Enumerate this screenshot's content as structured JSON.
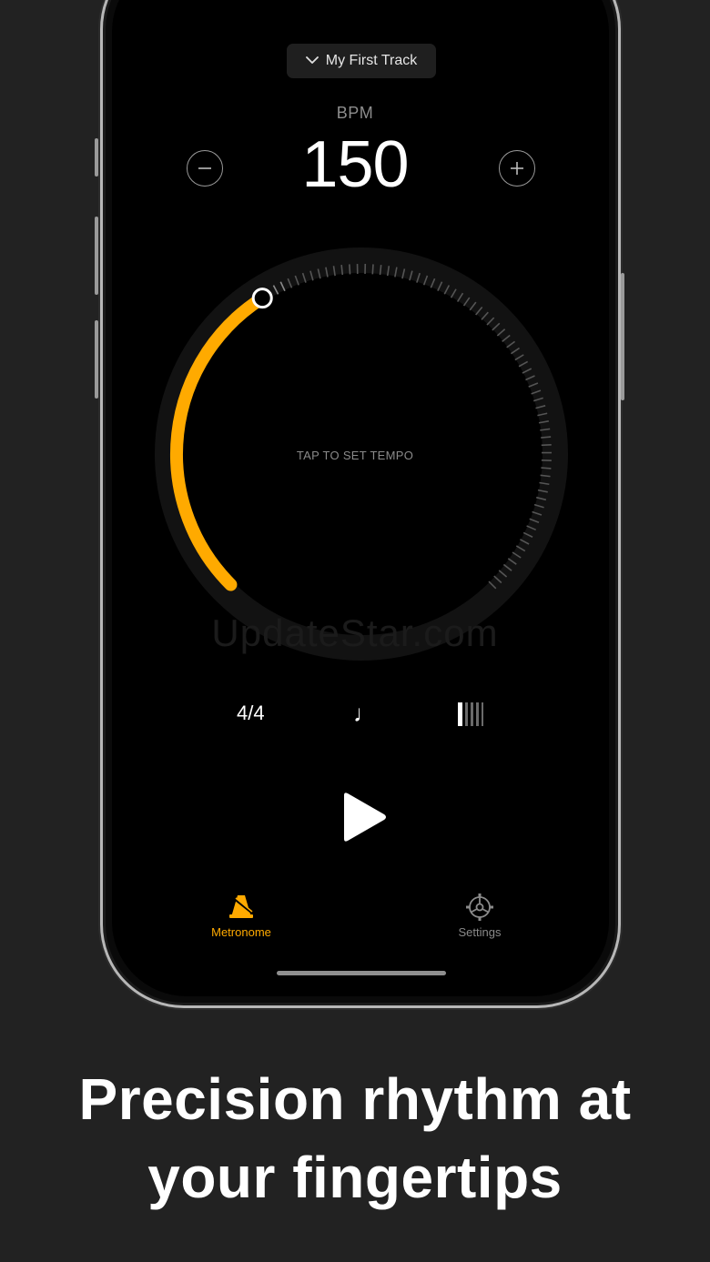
{
  "track": {
    "name": "My First Track"
  },
  "bpm": {
    "label": "BPM",
    "value": "150"
  },
  "dial": {
    "tap_label": "TAP TO SET TEMPO",
    "fill_fraction": 0.38,
    "accent": "#FFAA00"
  },
  "watermark": "UpdateStar.com",
  "controls": {
    "time_signature": "4/4",
    "note_value": "♩",
    "subdivision_icon": "bars-icon"
  },
  "tabs": [
    {
      "label": "Metronome",
      "icon": "metronome-icon",
      "active": true,
      "color": "#FFAA00"
    },
    {
      "label": "Settings",
      "icon": "gear-icon",
      "active": false,
      "color": "#8a8a8a"
    }
  ],
  "headline": {
    "line1": "Precision rhythm at",
    "line2": "your fingertips"
  }
}
